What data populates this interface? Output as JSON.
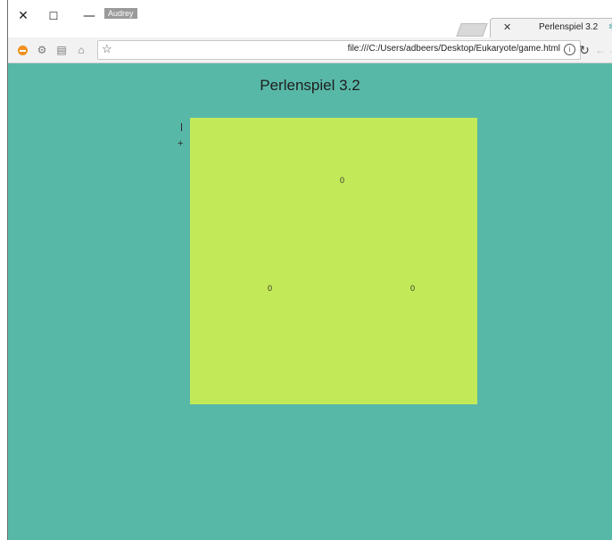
{
  "window": {
    "controls": {
      "close": "✕",
      "maximize": "☐",
      "minimize": "—"
    },
    "user_badge": "Audrey"
  },
  "tab": {
    "title": "Perlenspiel 3.2",
    "close_glyph": "✕",
    "favicon_glyph": "✻"
  },
  "toolbar": {
    "star_glyph": "☆",
    "url": "file:///C:/Users/adbeers/Desktop/Eukaryote/game.html",
    "info_glyph": "i",
    "icons": {
      "reload": "↻",
      "back": "←",
      "forward": "→",
      "ext_gray1": "⚙",
      "ext_gray2": "▤",
      "ext_gray3": "⌂"
    }
  },
  "page": {
    "title": "Perlenspiel 3.2",
    "grid_values": [
      "0",
      "0",
      "0"
    ],
    "side_plus": "+"
  },
  "colors": {
    "page_background": "#58b8a8",
    "grid_background": "#c2ea58"
  }
}
